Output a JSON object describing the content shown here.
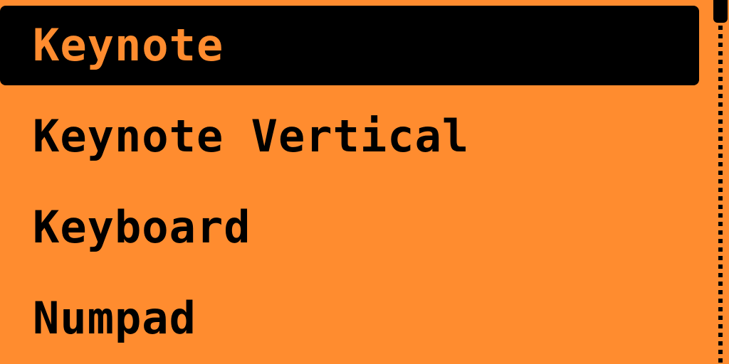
{
  "menu": {
    "items": [
      {
        "label": "Keynote",
        "selected": true
      },
      {
        "label": "Keynote Vertical",
        "selected": false
      },
      {
        "label": "Keyboard",
        "selected": false
      },
      {
        "label": "Numpad",
        "selected": false
      }
    ]
  },
  "colors": {
    "background": "#FF8C2F",
    "foreground": "#000000"
  }
}
